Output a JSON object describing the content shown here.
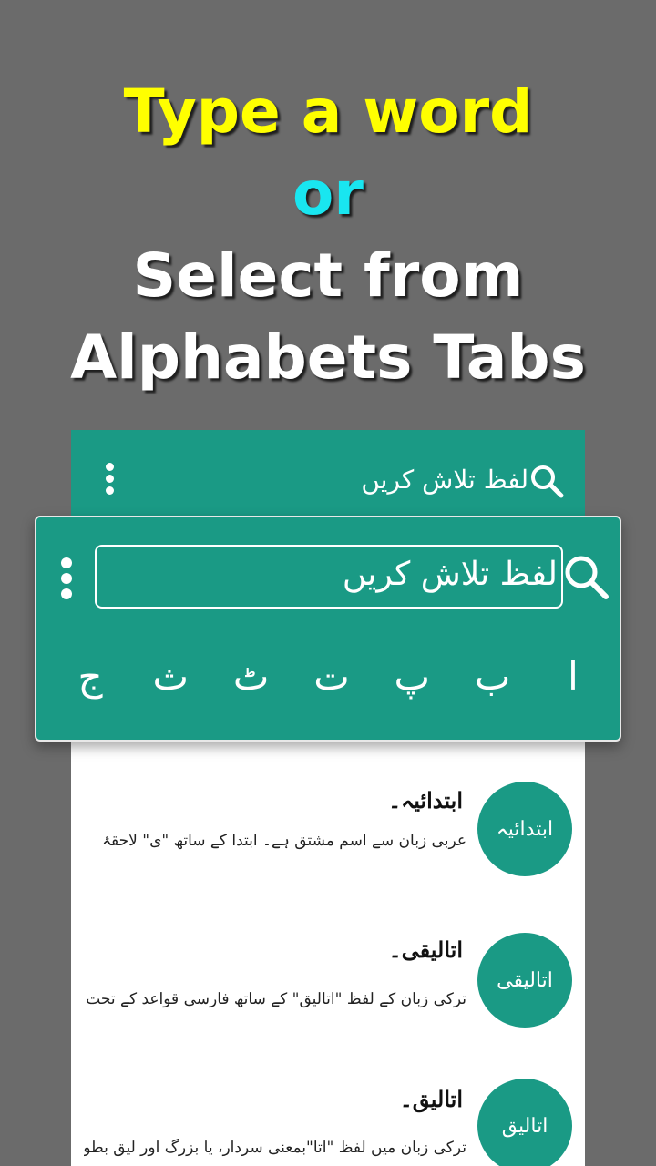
{
  "headline": {
    "line1": "Type a word",
    "line2": "or",
    "line3": "Select from",
    "line4": "Alphabets Tabs"
  },
  "appbar": {
    "title": "لفظ تلاش کریں",
    "icons": [
      "search-icon",
      "more-vert-icon"
    ]
  },
  "zoom": {
    "search_placeholder": "لفظ تلاش کریں",
    "tabs": [
      "ا",
      "ب",
      "پ",
      "ت",
      "ٹ",
      "ث",
      "ج"
    ]
  },
  "entries": [
    {
      "avatar": "ابتدائیہ",
      "word": "ابتدائیہ۔",
      "desc": "عربی زبان سے اسم مشتق ہے۔ ابتدا کے ساتھ \"ی\" لاحقۂ"
    },
    {
      "avatar": "اتالیقی",
      "word": "اتالیقی۔",
      "desc": "ترکی زبان کے لفظ \"اتالیق\" کے ساتھ فارسی قواعد کے تحت"
    },
    {
      "avatar": "اتالیق",
      "word": "اتالیق۔",
      "desc": "ترکی زبان میں لفظ \"اتا\"بمعنی سردار، یا بزرگ اور لیق بطور"
    }
  ],
  "colors": {
    "background": "#6b6b6b",
    "primary": "#1a9a85",
    "yellow": "#ffff00",
    "cyan": "#19e6f0"
  }
}
